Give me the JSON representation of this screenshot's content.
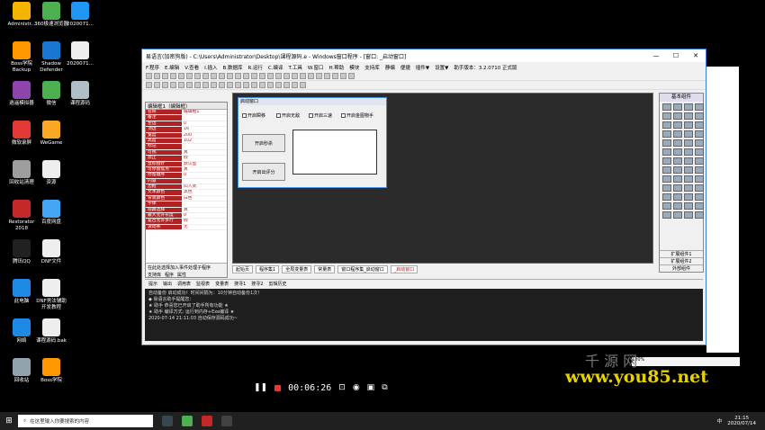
{
  "desktop": {
    "icons": [
      {
        "label": "Administr...",
        "color": "#f4b400"
      },
      {
        "label": "360极速浏览器",
        "color": "#4caf50"
      },
      {
        "label": "2020071...",
        "color": "#2196f3"
      },
      {
        "label": "Boss学院 Backup",
        "color": "#ff9800"
      },
      {
        "label": "Shadow Defender",
        "color": "#1976d2"
      },
      {
        "label": "2020071...",
        "color": "#eeeeee"
      },
      {
        "label": "逍遥模拟器",
        "color": "#8e44ad"
      },
      {
        "label": "微信",
        "color": "#4caf50"
      },
      {
        "label": "课程源码",
        "color": "#b0bec5"
      },
      {
        "label": "微软录屏",
        "color": "#e53935"
      },
      {
        "label": "WeGame",
        "color": "#f9a825"
      },
      {
        "label": "回收站清理",
        "color": "#9e9e9e"
      },
      {
        "label": "资源",
        "color": "#eeeeee"
      },
      {
        "label": "Restorator 2018",
        "color": "#c62828"
      },
      {
        "label": "百度网盘",
        "color": "#42a5f5"
      },
      {
        "label": "腾讯QQ",
        "color": "#212121"
      },
      {
        "label": "DNF文件",
        "color": "#eeeeee"
      },
      {
        "label": "此电脑",
        "color": "#1e88e5"
      },
      {
        "label": "DNF男法辅助开发教程",
        "color": "#eeeeee"
      },
      {
        "label": "网络",
        "color": "#1e88e5"
      },
      {
        "label": "课程源码.bak",
        "color": "#eeeeee"
      },
      {
        "label": "回收站",
        "color": "#90a4ae"
      },
      {
        "label": "Boss学院",
        "color": "#ff9800"
      }
    ]
  },
  "ide": {
    "title": "易语言(加密狗版) - C:\\Users\\Administrator\\Desktop\\课程源码.e - Windows窗口程序 - [窗口: _启动窗口]",
    "window_buttons": [
      "—",
      "☐",
      "✕"
    ],
    "menu": [
      "F.程序",
      "E.编辑",
      "V.查看",
      "I.插入",
      "B.数据库",
      "R.运行",
      "C.编译",
      "T.工具",
      "W.窗口",
      "H.帮助",
      "模块",
      "支持库",
      "静编",
      "便捷",
      "插件▼",
      "设置▼",
      "助手版本：3.2.0710 正式版"
    ],
    "props": {
      "header": "编辑框1（编辑框）",
      "rows": [
        {
          "name": "名称",
          "value": "编辑框1"
        },
        {
          "name": "备注",
          "value": ""
        },
        {
          "name": "左边",
          "value": "0"
        },
        {
          "name": "顶边",
          "value": "16"
        },
        {
          "name": "宽度",
          "value": "200"
        },
        {
          "name": "高度",
          "value": "102"
        },
        {
          "name": "标记",
          "value": ""
        },
        {
          "name": "可视",
          "value": "真"
        },
        {
          "name": "禁止",
          "value": "假"
        },
        {
          "name": "鼠标指针",
          "value": "默认型"
        },
        {
          "name": "可停留焦点",
          "value": "真"
        },
        {
          "name": "停留顺序",
          "value": "0"
        },
        {
          "name": "内容",
          "value": ""
        },
        {
          "name": "边框",
          "value": "凹入式"
        },
        {
          "name": "文本颜色",
          "value": "黑色"
        },
        {
          "name": "背景颜色",
          "value": "白色"
        },
        {
          "name": "字体",
          "value": ""
        },
        {
          "name": "隐藏选择",
          "value": "真"
        },
        {
          "name": "最大允许长度",
          "value": "0"
        },
        {
          "name": "是否允许多行",
          "value": "假"
        },
        {
          "name": "滚动条",
          "value": "无"
        }
      ],
      "footer_hint": "在此处选择加入事件处理子程序",
      "footer_tabs": [
        "支持库",
        "程序",
        "属性"
      ]
    },
    "form": {
      "title": "启动窗口",
      "checkboxes": [
        "开启瞬移",
        "开启无敌",
        "开启三速",
        "开启金图物手"
      ],
      "buttons": [
        "开启秒杀",
        "开启出评分"
      ]
    },
    "doc_tabs": [
      "起始页",
      "程序集1",
      "全局变量表",
      "常量表",
      "窗口程序集_启动窗口",
      "_启动窗口"
    ],
    "components": {
      "title": "基本组件",
      "footer": [
        "扩展组件1",
        "扩展组件2",
        "外部组件"
      ]
    },
    "output_tabs": [
      "提示",
      "输出",
      "调用表",
      "监视表",
      "变量表",
      "搜寻1",
      "搜寻2",
      "剪辑历史"
    ],
    "output_lines": [
      "自动备份 启动成功！时间间隔为：10分钟自动备份1次！",
      "◆ 易语言助手提醒您：",
      "★ 助手 恭喜您已开启了助手所有功能   ★",
      "★ 助手 编译方式: 运行到内存+Exe编译     ★",
      "2020-07-14 21:11:03 自动保存源码成功~"
    ]
  },
  "zoom": "100%",
  "watermark": "www.you85.net",
  "recorder": {
    "timer": "00:06:26"
  },
  "taskbar": {
    "search_placeholder": "在这里输入你要搜索的内容",
    "ime": "中",
    "time": "21:15",
    "date": "2020/07/14"
  }
}
